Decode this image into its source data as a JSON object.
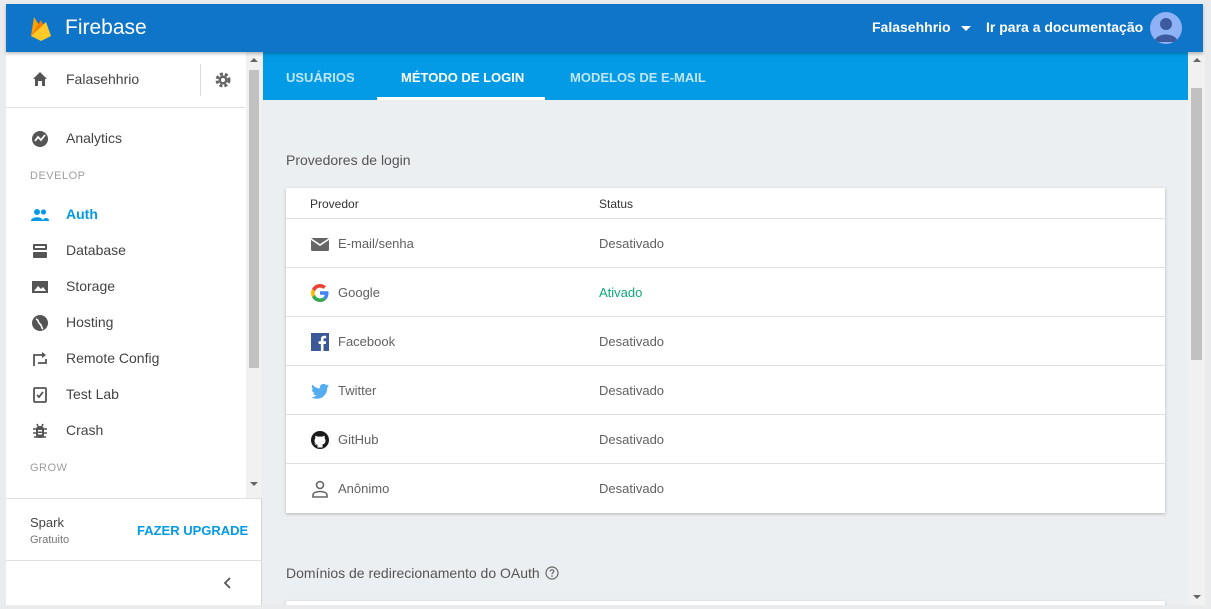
{
  "header": {
    "brand": "Firebase",
    "project": "Falasehhrio",
    "docs_link": "Ir para a documentação",
    "bar_color": "#0f75c9"
  },
  "sidebar": {
    "project_name": "Falasehhrio",
    "items": [
      {
        "label": "Analytics",
        "icon": "analytics-icon"
      },
      {
        "label": "Auth",
        "icon": "people-icon",
        "active": true
      },
      {
        "label": "Database",
        "icon": "database-icon"
      },
      {
        "label": "Storage",
        "icon": "image-icon"
      },
      {
        "label": "Hosting",
        "icon": "globe-icon"
      },
      {
        "label": "Remote Config",
        "icon": "remote-config-icon"
      },
      {
        "label": "Test Lab",
        "icon": "test-lab-icon"
      },
      {
        "label": "Crash",
        "icon": "bug-icon"
      }
    ],
    "section_develop": "DEVELOP",
    "section_grow": "GROW",
    "plan_name": "Spark",
    "plan_tier": "Gratuito",
    "upgrade_label": "FAZER UPGRADE"
  },
  "tabs": [
    {
      "label": "USUÁRIOS"
    },
    {
      "label": "MÉTODO DE LOGIN",
      "active": true
    },
    {
      "label": "MODELOS DE E-MAIL"
    }
  ],
  "providers": {
    "title": "Provedores de login",
    "col_provider": "Provedor",
    "col_status": "Status",
    "rows": [
      {
        "name": "E-mail/senha",
        "status": "Desativado",
        "icon": "mail-icon"
      },
      {
        "name": "Google",
        "status": "Ativado",
        "icon": "google-icon"
      },
      {
        "name": "Facebook",
        "status": "Desativado",
        "icon": "facebook-icon"
      },
      {
        "name": "Twitter",
        "status": "Desativado",
        "icon": "twitter-icon"
      },
      {
        "name": "GitHub",
        "status": "Desativado",
        "icon": "github-icon"
      },
      {
        "name": "Anônimo",
        "status": "Desativado",
        "icon": "person-icon"
      }
    ]
  },
  "oauth": {
    "title": "Domínios de redirecionamento do OAuth"
  },
  "colors": {
    "tab_bar": "#039be5",
    "active_nav": "#039be5",
    "enabled_status": "#0fa67a"
  }
}
